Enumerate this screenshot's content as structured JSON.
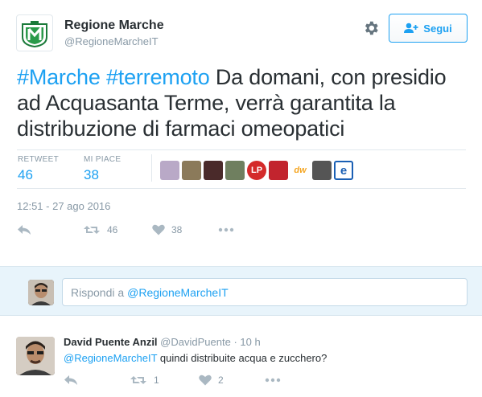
{
  "tweet": {
    "author_name": "Regione Marche",
    "author_handle": "@RegioneMarcheIT",
    "follow_label": "Segui",
    "hashtag1": "#Marche",
    "hashtag2": "#terremoto",
    "text": "Da domani, con presidio ad Acquasanta Terme, verrà garantita  la distribuzione di farmaci omeopatici",
    "retweet_label": "RETWEET",
    "retweet_count": "46",
    "like_label": "MI PIACE",
    "like_count": "38",
    "timestamp": "12:51 - 27 ago 2016",
    "action_retweets": "46",
    "action_likes": "38",
    "likers": [
      {
        "icon": "avatar-photo",
        "color": "#b9a9c7",
        "text": ""
      },
      {
        "icon": "avatar-cat",
        "color": "#8b7a5a",
        "text": ""
      },
      {
        "icon": "avatar-photo",
        "color": "#4a2a2a",
        "text": ""
      },
      {
        "icon": "avatar-photo",
        "color": "#6f7f5f",
        "text": ""
      },
      {
        "icon": "avatar-logo",
        "color": "#d42a2a",
        "text": "LP"
      },
      {
        "icon": "avatar-photo",
        "color": "#c2242e",
        "text": ""
      },
      {
        "icon": "avatar-logo",
        "color": "#f5a623",
        "text": "dw"
      },
      {
        "icon": "avatar-photo",
        "color": "#555555",
        "text": ""
      },
      {
        "icon": "avatar-logo",
        "color": "#1a5fb4",
        "text": "e"
      }
    ]
  },
  "reply_box": {
    "prefix": "Rispondi a",
    "mention": "@RegioneMarcheIT"
  },
  "reply": {
    "author_name": "David Puente Anzil",
    "author_handle": "@DavidPuente",
    "time": "· 10 h",
    "mention": "@RegioneMarcheIT",
    "text": "quindi distribuite acqua e zucchero?",
    "retweet_count": "1",
    "like_count": "2"
  },
  "colors": {
    "accent": "#1da1f2",
    "muted": "#8899a6",
    "reply_bar_bg": "#e8f4fb"
  }
}
